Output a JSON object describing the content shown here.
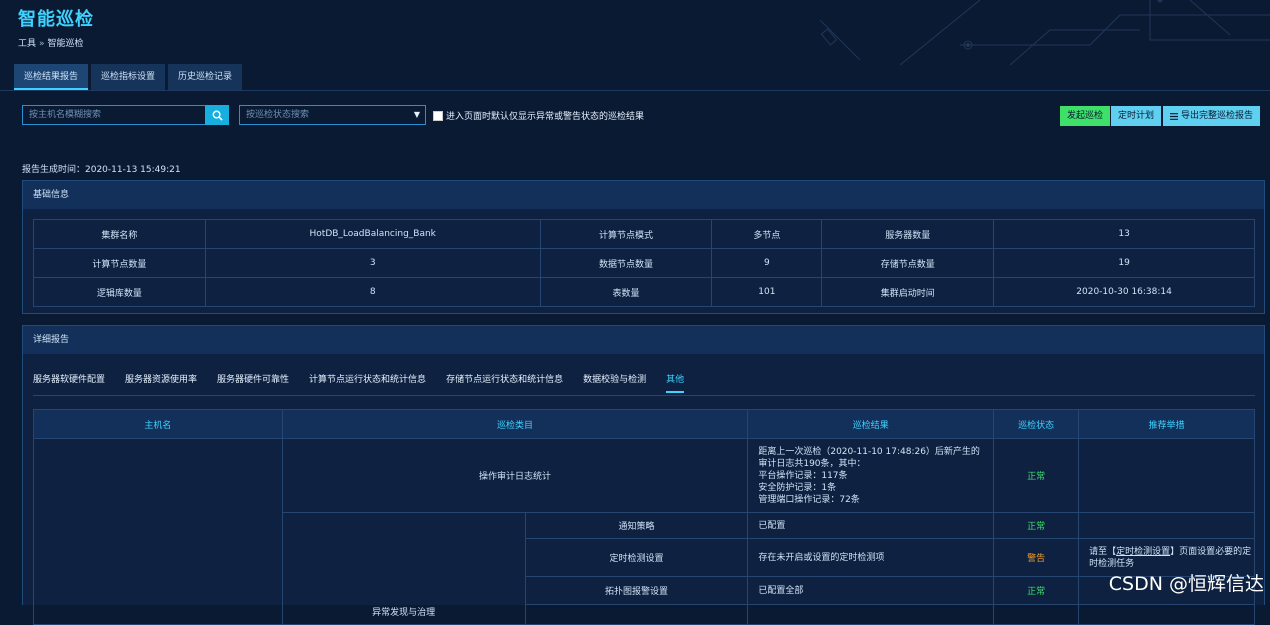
{
  "page": {
    "title": "智能巡检"
  },
  "breadcrumb": {
    "root": "工具",
    "sep": "»",
    "current": "智能巡检"
  },
  "tabs": [
    {
      "label": "巡检结果报告",
      "active": true
    },
    {
      "label": "巡检指标设置",
      "active": false
    },
    {
      "label": "历史巡检记录",
      "active": false
    }
  ],
  "toolbar": {
    "search_placeholder": "按主机名模糊搜索",
    "status_placeholder": "按巡检状态搜索",
    "checkbox_label": "进入页面时默认仅显示异常或警告状态的巡检结果",
    "start_label": "发起巡检",
    "schedule_label": "定时计划",
    "export_label": "导出完整巡检报告"
  },
  "report": {
    "time_text": "报告生成时间：2020-11-13 15:49:21"
  },
  "basic": {
    "title": "基础信息",
    "rows": [
      [
        "集群名称",
        "HotDB_LoadBalancing_Bank",
        "计算节点模式",
        "多节点",
        "服务器数量",
        "13"
      ],
      [
        "计算节点数量",
        "3",
        "数据节点数量",
        "9",
        "存储节点数量",
        "19"
      ],
      [
        "逻辑库数量",
        "8",
        "表数量",
        "101",
        "集群启动时间",
        "2020-10-30 16:38:14"
      ]
    ]
  },
  "detail": {
    "title": "详细报告",
    "subtabs": [
      {
        "label": "服务器软硬件配置",
        "active": false
      },
      {
        "label": "服务器资源使用率",
        "active": false
      },
      {
        "label": "服务器硬件可靠性",
        "active": false
      },
      {
        "label": "计算节点运行状态和统计信息",
        "active": false
      },
      {
        "label": "存储节点运行状态和统计信息",
        "active": false
      },
      {
        "label": "数据校验与检测",
        "active": false
      },
      {
        "label": "其他",
        "active": true
      }
    ],
    "headers": [
      "主机名",
      "巡检类目",
      "巡检结果",
      "巡检状态",
      "推荐举措"
    ],
    "audit": {
      "category": "操作审计日志统计",
      "result_lines": [
        "距离上一次巡检（2020-11-10 17:48:26）后新产生的",
        "审计日志共190条，其中：",
        "平台操作记录：117条",
        "安全防护记录：1条",
        "管理端口操作记录：72条"
      ],
      "status": "正常"
    },
    "group": "异常发现与治理",
    "items": [
      {
        "name": "通知策略",
        "result": "已配置",
        "status": "正常"
      },
      {
        "name": "定时检测设置",
        "result": "存在未开启或设置的定时检测项",
        "status": "警告",
        "rec_pre": "请至【",
        "rec_link": "定时检测设置",
        "rec_post": "】页面设置必要的定时检测任务"
      },
      {
        "name": "拓扑图报警设置",
        "result": "已配置全部",
        "status": "正常"
      }
    ]
  },
  "watermark": "CSDN @恒辉信达"
}
